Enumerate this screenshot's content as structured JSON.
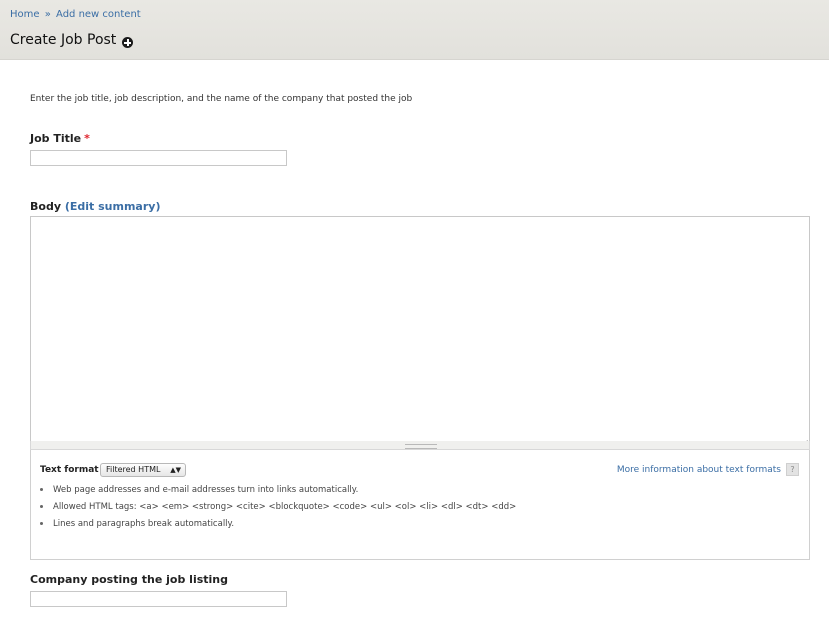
{
  "breadcrumb": {
    "home": "Home",
    "separator": "»",
    "add_new_content": "Add new content"
  },
  "page": {
    "title": "Create Job Post"
  },
  "form": {
    "help_text": "Enter the job title, job description, and the name of the company that posted the job",
    "job_title": {
      "label": "Job Title",
      "required_mark": "*",
      "value": ""
    },
    "body": {
      "label": "Body",
      "open_paren": "(",
      "edit_summary_link": "Edit summary",
      "close_paren": ")",
      "value": ""
    },
    "text_format": {
      "label": "Text format",
      "selected": "Filtered HTML",
      "more_info_link": "More information about text formats",
      "help_icon": "?",
      "tips": [
        "Web page addresses and e-mail addresses turn into links automatically.",
        "Allowed HTML tags: <a> <em> <strong> <cite> <blockquote> <code> <ul> <ol> <li> <dl> <dt> <dd>",
        "Lines and paragraphs break automatically."
      ]
    },
    "company": {
      "label": "Company posting the job listing",
      "value": ""
    }
  },
  "icons": {
    "add_shortcut": "plus-circle-icon",
    "help": "help-icon",
    "select_arrows": "up-down-arrows-icon",
    "resize": "resize-grip-icon"
  },
  "colors": {
    "link": "#3b6ea5",
    "required": "#e0252e",
    "header_bg": "#e6e5e0"
  }
}
